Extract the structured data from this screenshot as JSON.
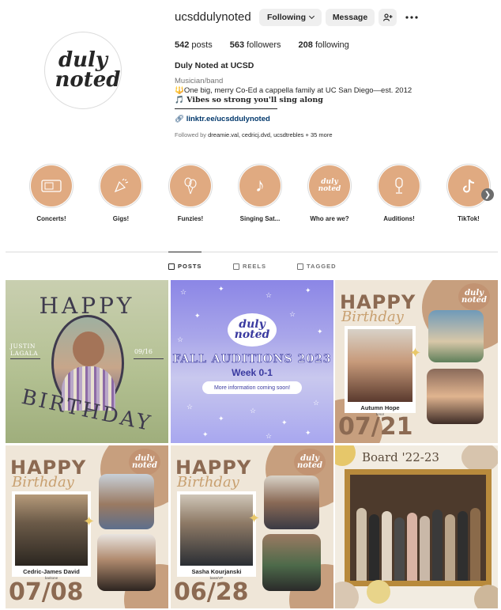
{
  "profile": {
    "username": "ucsddulynoted",
    "following_button": "Following",
    "message_button": "Message",
    "suggest_icon": "add-person-icon",
    "more_icon": "more-horizontal-icon",
    "avatar_logo_line1": "duly",
    "avatar_logo_line2": "noted",
    "posts_count": "542",
    "posts_label": "posts",
    "followers_count": "563",
    "followers_label": "followers",
    "following_count": "208",
    "following_label": "following",
    "full_name": "Duly Noted at UCSD",
    "category": "Musician/band",
    "bio_line1": "One big, merry Co-Ed a cappella family at UC San Diego—est. 2012",
    "bio_line2": "Vibes so strong you'll sing along",
    "link": "linktr.ee/ucsddulynoted",
    "followed_by_prefix": "Followed by",
    "followed_by_names": "dreamie.val, cedricj.dvd, ucsdtrebles",
    "followed_by_more": "+ 35 more"
  },
  "highlights": [
    {
      "label": "Concerts!",
      "icon": "ticket-icon"
    },
    {
      "label": "Gigs!",
      "icon": "party-icon"
    },
    {
      "label": "Funzies!",
      "icon": "balloons-icon"
    },
    {
      "label": "Singing Sat...",
      "icon": "music-note-icon"
    },
    {
      "label": "Who are we?",
      "icon": "duly-noted-logo-icon"
    },
    {
      "label": "Auditions!",
      "icon": "microphone-icon"
    },
    {
      "label": "TikTok!",
      "icon": "tiktok-icon"
    }
  ],
  "tabs": [
    {
      "label": "POSTS",
      "active": true
    },
    {
      "label": "REELS",
      "active": false
    },
    {
      "label": "TAGGED",
      "active": false
    }
  ],
  "posts": {
    "p1": {
      "happy": "HAPPY",
      "birthday": "BIRTHDAY",
      "name_line1": "JUSTIN",
      "name_line2": "LAGALA",
      "date": "09/16"
    },
    "p2": {
      "logo_line1": "duly",
      "logo_line2": "noted",
      "title": "FALL AUDITIONS 2023",
      "subtitle": "Week 0-1",
      "pill": "More information coming soon!"
    },
    "p3": {
      "happy": "HAPPY",
      "birthday": "Birthday",
      "name": "Autumn Hope",
      "role": "tenor",
      "date": "07/21",
      "logo_line1": "duly",
      "logo_line2": "noted"
    },
    "p4": {
      "happy": "HAPPY",
      "birthday": "Birthday",
      "name": "Cedric-James David",
      "role": "baritone",
      "date": "07/08",
      "logo_line1": "duly",
      "logo_line2": "noted"
    },
    "p5": {
      "happy": "HAPPY",
      "birthday": "Birthday",
      "name": "Sasha Kourjanski",
      "role": "bass/VP",
      "date": "06/28",
      "logo_line1": "duly",
      "logo_line2": "noted"
    },
    "p6": {
      "title": "Board '22-23"
    }
  },
  "colors": {
    "highlight_fill": "#e0aa81",
    "link": "#00376b",
    "muted": "#737373",
    "brand_brown": "#8c6a52"
  }
}
